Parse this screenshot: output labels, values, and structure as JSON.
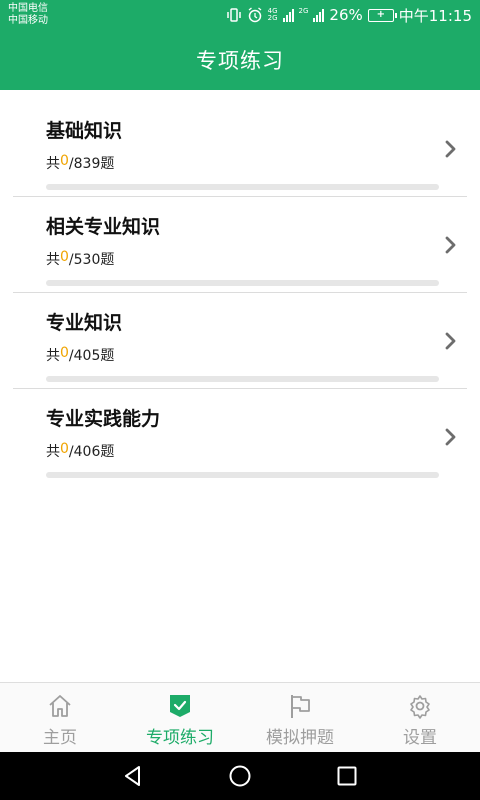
{
  "status_bar": {
    "carrier_1": "中国电信",
    "carrier_2": "中国移动",
    "net_1": "4G",
    "net_2": "2G",
    "net_3": "2G",
    "battery_percent": "26%",
    "time": "中午11:15"
  },
  "header": {
    "title": "专项练习"
  },
  "categories": [
    {
      "title": "基础知识",
      "prefix": "共",
      "done": "0",
      "total": "/839题",
      "progress": 0
    },
    {
      "title": "相关专业知识",
      "prefix": "共",
      "done": "0",
      "total": "/530题",
      "progress": 0
    },
    {
      "title": "专业知识",
      "prefix": "共",
      "done": "0",
      "total": "/405题",
      "progress": 0
    },
    {
      "title": "专业实践能力",
      "prefix": "共",
      "done": "0",
      "total": "/406题",
      "progress": 0
    }
  ],
  "tabs": [
    {
      "label": "主页",
      "icon": "home-icon",
      "active": false
    },
    {
      "label": "专项练习",
      "icon": "shield-check-icon",
      "active": true
    },
    {
      "label": "模拟押题",
      "icon": "flag-icon",
      "active": false
    },
    {
      "label": "设置",
      "icon": "gear-icon",
      "active": false
    }
  ],
  "colors": {
    "primary": "#1dab68",
    "done_count": "#f0a400",
    "tab_inactive": "#9e9e9e"
  }
}
